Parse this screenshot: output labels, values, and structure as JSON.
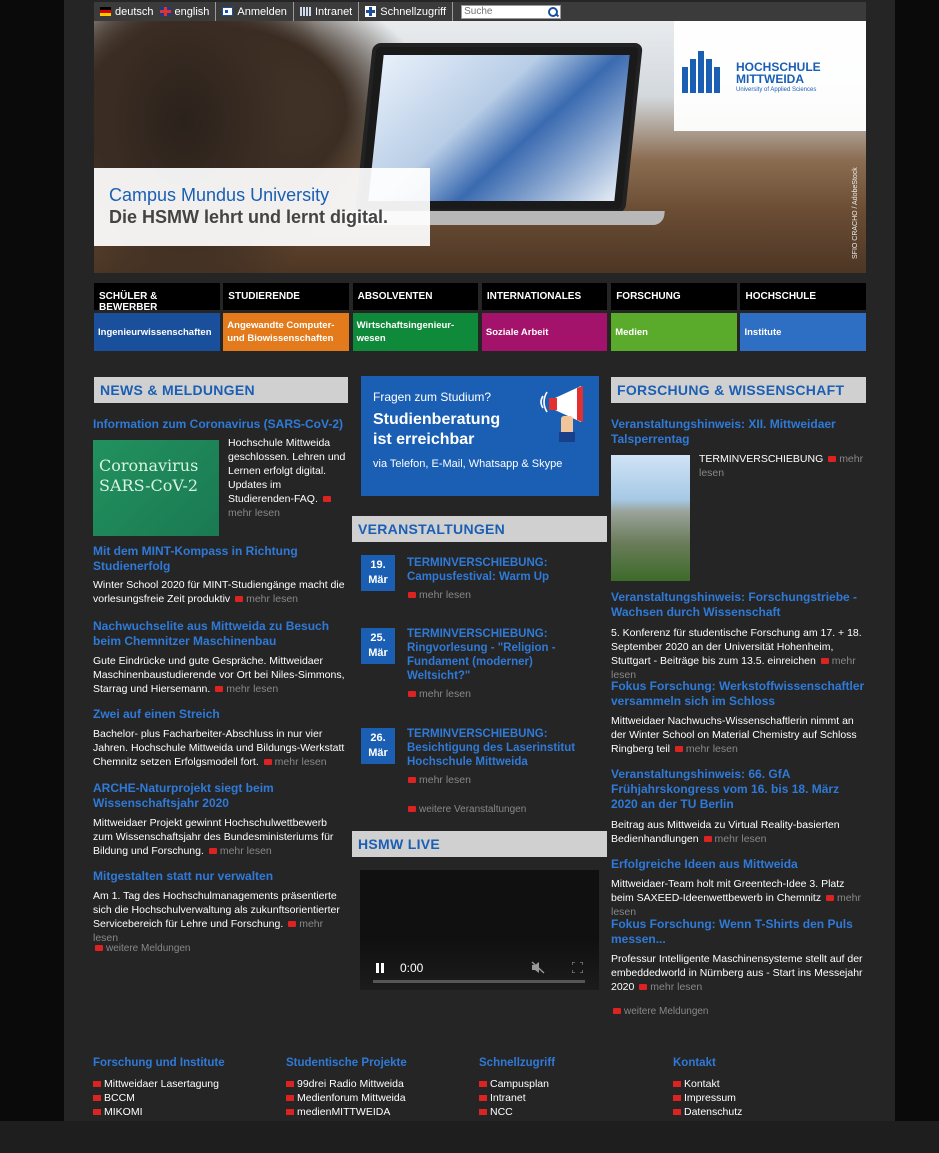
{
  "topbar": {
    "lang_de": "deutsch",
    "lang_en": "english",
    "login": "Anmelden",
    "intranet": "Intranet",
    "quick": "Schnellzugriff",
    "search_placeholder": "Suche"
  },
  "hero": {
    "caption1": "Campus Mundus University",
    "caption2": "Die HSMW lehrt und lernt digital.",
    "logo_line1": "HOCHSCHULE",
    "logo_line2": "MITTWEIDA",
    "logo_sub": "University of Applied Sciences",
    "credit": "SFIO CRACHO / AdobeStock"
  },
  "nav": {
    "top": [
      "Schüler & Bewerber",
      "Studierende",
      "Absolventen",
      "Internationales",
      "Forschung",
      "Hochschule"
    ],
    "sub": [
      {
        "label": "Ingenieurwissenschaften",
        "color": "#1a4f9c"
      },
      {
        "label": "Angewandte Computer- und Biowissenschaften",
        "color": "#e37a1c"
      },
      {
        "label": "Wirtschaftsingenieur-wesen",
        "color": "#0f8a3a"
      },
      {
        "label": "Soziale Arbeit",
        "color": "#a3126b"
      },
      {
        "label": "Medien",
        "color": "#5aab2c"
      },
      {
        "label": "Institute",
        "color": "#2e6fc4"
      }
    ]
  },
  "news": {
    "heading": "NEWS & MELDUNGEN",
    "more": "mehr lesen",
    "all": "weitere Meldungen",
    "chalk": "Coronavirus SARS-CoV-2",
    "items": [
      {
        "title": "Information zum Coronavirus (SARS-CoV-2)",
        "text": "Hochschule Mittweida geschlossen. Lehren und Lernen erfolgt digital. Updates im Studierenden-FAQ."
      },
      {
        "title": "Mit dem MINT-Kompass in Richtung Studienerfolg",
        "text": "Winter School 2020 für MINT-Studiengänge macht die vorlesungsfreie Zeit produktiv"
      },
      {
        "title": "Nachwuchselite aus Mittweida zu Besuch beim Chemnitzer Maschinenbau",
        "text": "Gute Eindrücke und gute Gespräche. Mittweidaer Maschinenbaustudierende vor Ort bei Niles-Simmons, Starrag und Hiersemann."
      },
      {
        "title": "Zwei auf einen Streich",
        "text": "Bachelor- plus Facharbeiter-Abschluss in nur vier Jahren. Hochschule Mittweida und Bildungs-Werkstatt Chemnitz setzen Erfolgsmodell fort."
      },
      {
        "title": "ARCHE-Naturprojekt siegt beim Wissenschaftsjahr 2020",
        "text": "Mittweidaer Projekt gewinnt Hochschulwettbewerb zum Wissenschaftsjahr des Bundesministeriums für Bildung und Forschung."
      },
      {
        "title": "Mitgestalten statt nur verwalten",
        "text": "Am 1. Tag des Hochschulmanagements präsentierte sich die Hochschulverwaltung als zukunftsorientierter Servicebereich für Lehre und Forschung."
      }
    ]
  },
  "banner": {
    "line1": "Fragen zum Studium?",
    "line2": "Studienberatung ist erreichbar",
    "line3": "via Telefon, E-Mail, Whatsapp & Skype"
  },
  "events": {
    "heading": "VERANSTALTUNGEN",
    "more": "mehr lesen",
    "all": "weitere Veranstaltungen",
    "items": [
      {
        "day": "19.",
        "month": "Mär",
        "title": "TERMINVERSCHIEBUNG: Campusfestival: Warm Up"
      },
      {
        "day": "25.",
        "month": "Mär",
        "title": "TERMINVERSCHIEBUNG: Ringvorlesung - \"Religion - Fundament (moderner) Weltsicht?\""
      },
      {
        "day": "26.",
        "month": "Mär",
        "title": "TERMINVERSCHIEBUNG: Besichtigung des Laserinstitut Hochschule Mittweida"
      }
    ]
  },
  "live": {
    "heading": "HSMW LIVE",
    "time": "0:00"
  },
  "research": {
    "heading": "FORSCHUNG & WISSENSCHAFT",
    "more": "mehr lesen",
    "all": "weitere Meldungen",
    "items": [
      {
        "title": "Veranstaltungshinweis: XII. Mittweidaer Talsperrentag",
        "text": "TERMINVERSCHIEBUNG"
      },
      {
        "title": "Veranstaltungshinweis: Forschungstriebe - Wachsen durch Wissenschaft",
        "text": "5. Konferenz für studentische Forschung am 17. + 18. September 2020 an der Universität Hohenheim, Stuttgart - Beiträge bis zum 13.5. einreichen"
      },
      {
        "title": "Fokus Forschung: Werkstoffwissenschaftler versammeln sich im Schloss",
        "text": "Mittweidaer Nachwuchs-Wissenschaftlerin nimmt an der Winter School on Material Chemistry auf Schloss Ringberg teil"
      },
      {
        "title": "Veranstaltungshinweis: 66. GfA Frühjahrskongress vom 16. bis 18. März 2020 an der TU Berlin",
        "text": "Beitrag aus Mittweida zu Virtual Reality-basierten Bedienhandlungen"
      },
      {
        "title": "Erfolgreiche Ideen aus Mittweida",
        "text": "Mittweidaer-Team holt mit Greentech-Idee 3. Platz beim SAXEED-Ideenwettbewerb in Chemnitz"
      },
      {
        "title": "Fokus Forschung: Wenn T-Shirts den Puls messen...",
        "text": "Professur Intelligente Maschinensysteme stellt auf der embeddedworld in Nürnberg aus - Start ins Messejahr 2020"
      }
    ]
  },
  "footer": {
    "cols": [
      {
        "heading": "Forschung und Institute",
        "items": [
          "Mittweidaer Lasertagung",
          "BCCM",
          "MIKOMI"
        ]
      },
      {
        "heading": "Studentische Projekte",
        "items": [
          "99drei Radio Mittweida",
          "Medienforum Mittweida",
          "medienMITTWEIDA"
        ]
      },
      {
        "heading": "Schnellzugriff",
        "items": [
          "Campusplan",
          "Intranet",
          "NCC"
        ]
      },
      {
        "heading": "Kontakt",
        "items": [
          "Kontakt",
          "Impressum",
          "Datenschutz"
        ]
      }
    ]
  }
}
